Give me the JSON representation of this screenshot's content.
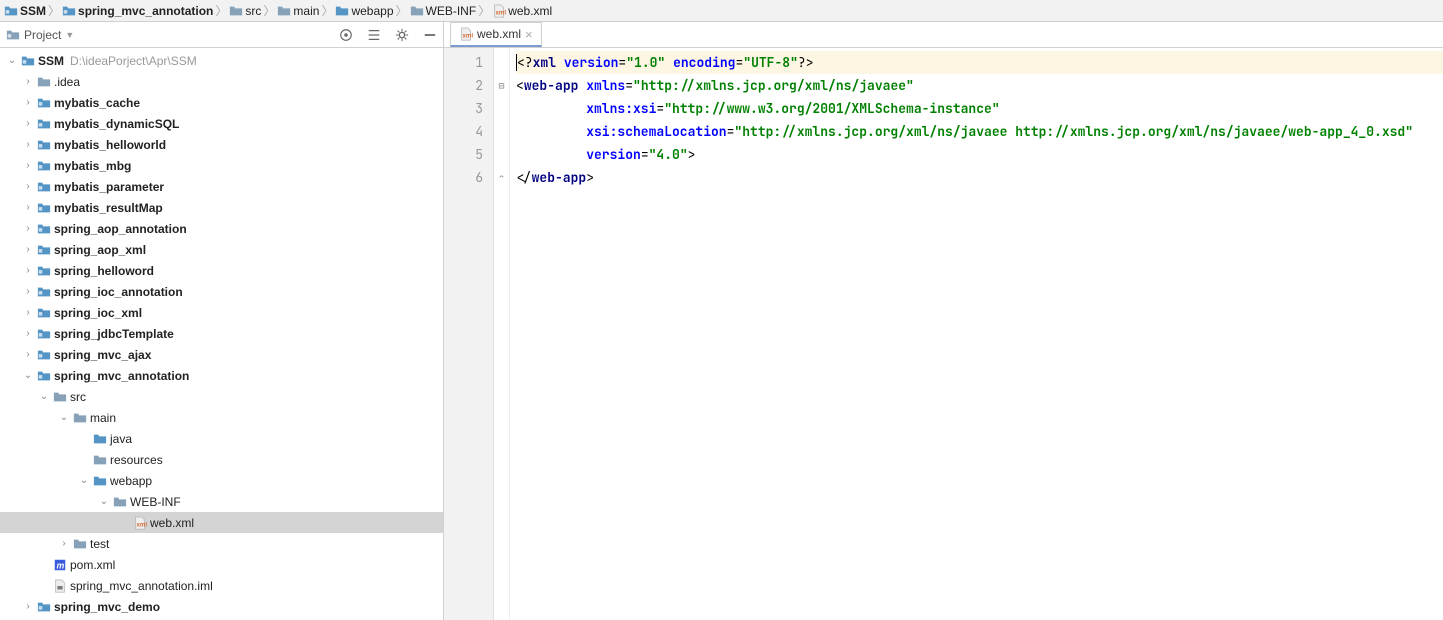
{
  "breadcrumb": [
    {
      "label": "SSM",
      "icon": "module",
      "bold": true
    },
    {
      "label": "spring_mvc_annotation",
      "icon": "module",
      "bold": true
    },
    {
      "label": "src",
      "icon": "folder"
    },
    {
      "label": "main",
      "icon": "folder"
    },
    {
      "label": "webapp",
      "icon": "folder-blue"
    },
    {
      "label": "WEB-INF",
      "icon": "folder"
    },
    {
      "label": "web.xml",
      "icon": "xml"
    }
  ],
  "sidebar": {
    "title": "Project",
    "tools": [
      "target-icon",
      "collapse-icon",
      "gear-icon",
      "hide-icon"
    ]
  },
  "tree": [
    {
      "indent": 0,
      "arrow": "down",
      "icon": "module",
      "label": "SSM",
      "bold": true,
      "path": "D:\\ideaPorject\\Apr\\SSM"
    },
    {
      "indent": 1,
      "arrow": "right",
      "icon": "folder",
      "label": ".idea"
    },
    {
      "indent": 1,
      "arrow": "right",
      "icon": "module",
      "label": "mybatis_cache",
      "bold": true
    },
    {
      "indent": 1,
      "arrow": "right",
      "icon": "module",
      "label": "mybatis_dynamicSQL",
      "bold": true
    },
    {
      "indent": 1,
      "arrow": "right",
      "icon": "module",
      "label": "mybatis_helloworld",
      "bold": true
    },
    {
      "indent": 1,
      "arrow": "right",
      "icon": "module",
      "label": "mybatis_mbg",
      "bold": true
    },
    {
      "indent": 1,
      "arrow": "right",
      "icon": "module",
      "label": "mybatis_parameter",
      "bold": true
    },
    {
      "indent": 1,
      "arrow": "right",
      "icon": "module",
      "label": "mybatis_resultMap",
      "bold": true
    },
    {
      "indent": 1,
      "arrow": "right",
      "icon": "module",
      "label": "spring_aop_annotation",
      "bold": true
    },
    {
      "indent": 1,
      "arrow": "right",
      "icon": "module",
      "label": "spring_aop_xml",
      "bold": true
    },
    {
      "indent": 1,
      "arrow": "right",
      "icon": "module",
      "label": "spring_helloword",
      "bold": true
    },
    {
      "indent": 1,
      "arrow": "right",
      "icon": "module",
      "label": "spring_ioc_annotation",
      "bold": true
    },
    {
      "indent": 1,
      "arrow": "right",
      "icon": "module",
      "label": "spring_ioc_xml",
      "bold": true
    },
    {
      "indent": 1,
      "arrow": "right",
      "icon": "module",
      "label": "spring_jdbcTemplate",
      "bold": true
    },
    {
      "indent": 1,
      "arrow": "right",
      "icon": "module",
      "label": "spring_mvc_ajax",
      "bold": true
    },
    {
      "indent": 1,
      "arrow": "down",
      "icon": "module",
      "label": "spring_mvc_annotation",
      "bold": true
    },
    {
      "indent": 2,
      "arrow": "down",
      "icon": "folder",
      "label": "src"
    },
    {
      "indent": 3,
      "arrow": "down",
      "icon": "folder",
      "label": "main"
    },
    {
      "indent": 4,
      "arrow": "",
      "icon": "folder-blue",
      "label": "java"
    },
    {
      "indent": 4,
      "arrow": "",
      "icon": "folder",
      "label": "resources"
    },
    {
      "indent": 4,
      "arrow": "down",
      "icon": "folder-blue",
      "label": "webapp"
    },
    {
      "indent": 5,
      "arrow": "down",
      "icon": "folder",
      "label": "WEB-INF"
    },
    {
      "indent": 6,
      "arrow": "",
      "icon": "xml",
      "label": "web.xml",
      "selected": true
    },
    {
      "indent": 3,
      "arrow": "right",
      "icon": "folder",
      "label": "test"
    },
    {
      "indent": 2,
      "arrow": "",
      "icon": "maven",
      "label": "pom.xml"
    },
    {
      "indent": 2,
      "arrow": "",
      "icon": "iml",
      "label": "spring_mvc_annotation.iml"
    },
    {
      "indent": 1,
      "arrow": "right",
      "icon": "module",
      "label": "spring_mvc_demo",
      "bold": true
    }
  ],
  "editor": {
    "tab": {
      "label": "web.xml",
      "icon": "xml"
    },
    "lines": [
      {
        "n": 1,
        "hl": true,
        "fold": "",
        "tokens": [
          {
            "t": "caret"
          },
          {
            "c": "punc",
            "t": "<?"
          },
          {
            "c": "tag",
            "t": "xml "
          },
          {
            "c": "attr",
            "t": "version"
          },
          {
            "c": "punc",
            "t": "="
          },
          {
            "c": "str",
            "t": "\"1.0\""
          },
          {
            "c": "tag",
            "t": " "
          },
          {
            "c": "attr",
            "t": "encoding"
          },
          {
            "c": "punc",
            "t": "="
          },
          {
            "c": "str",
            "t": "\"UTF-8\""
          },
          {
            "c": "punc",
            "t": "?>"
          }
        ]
      },
      {
        "n": 2,
        "fold": "down",
        "tokens": [
          {
            "c": "punc",
            "t": "<"
          },
          {
            "c": "tag",
            "t": "web-app "
          },
          {
            "c": "attr",
            "t": "xmlns"
          },
          {
            "c": "punc",
            "t": "="
          },
          {
            "c": "str",
            "t": "\"http://xmlns.jcp.org/xml/ns/javaee\""
          }
        ]
      },
      {
        "n": 3,
        "tokens": [
          {
            "c": "punc",
            "t": "         "
          },
          {
            "c": "attr",
            "t": "xmlns:xsi"
          },
          {
            "c": "punc",
            "t": "="
          },
          {
            "c": "str",
            "t": "\"http://www.w3.org/2001/XMLSchema-instance\""
          }
        ]
      },
      {
        "n": 4,
        "tokens": [
          {
            "c": "punc",
            "t": "         "
          },
          {
            "c": "attr",
            "t": "xsi:schemaLocation"
          },
          {
            "c": "punc",
            "t": "="
          },
          {
            "c": "str",
            "t": "\"http://xmlns.jcp.org/xml/ns/javaee http://xmlns.jcp.org/xml/ns/javaee/web-app_4_0.xsd\""
          }
        ]
      },
      {
        "n": 5,
        "tokens": [
          {
            "c": "punc",
            "t": "         "
          },
          {
            "c": "attr",
            "t": "version"
          },
          {
            "c": "punc",
            "t": "="
          },
          {
            "c": "str",
            "t": "\"4.0\""
          },
          {
            "c": "punc",
            "t": ">"
          }
        ]
      },
      {
        "n": 6,
        "fold": "up",
        "tokens": [
          {
            "c": "punc",
            "t": "</"
          },
          {
            "c": "tag",
            "t": "web-app"
          },
          {
            "c": "punc",
            "t": ">"
          }
        ]
      }
    ]
  }
}
